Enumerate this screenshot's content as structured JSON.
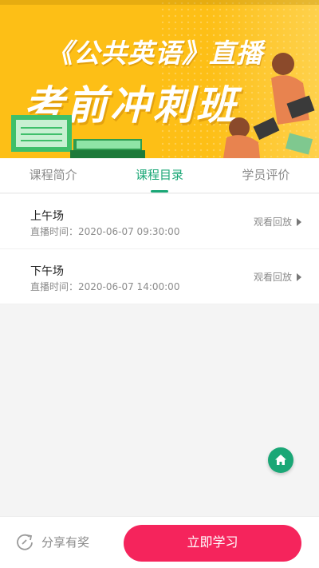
{
  "banner": {
    "subtitle": "《公共英语》直播",
    "title": "考前冲刺班"
  },
  "tabs": [
    {
      "label": "课程简介",
      "active": false
    },
    {
      "label": "课程目录",
      "active": true
    },
    {
      "label": "学员评价",
      "active": false
    }
  ],
  "sessions": [
    {
      "name": "上午场",
      "time": "直播时间：2020-06-07 09:30:00",
      "action": "观看回放"
    },
    {
      "name": "下午场",
      "time": "直播时间：2020-06-07 14:00:00",
      "action": "观看回放"
    }
  ],
  "bottom": {
    "share_label": "分享有奖",
    "study_label": "立即学习"
  },
  "colors": {
    "accent_green": "#1aa776",
    "cta_pink": "#f5245c",
    "banner_yellow": "#fdbf16"
  },
  "icons": {
    "fab": "home-icon",
    "share": "share-icon",
    "replay": "play-triangle-icon"
  }
}
